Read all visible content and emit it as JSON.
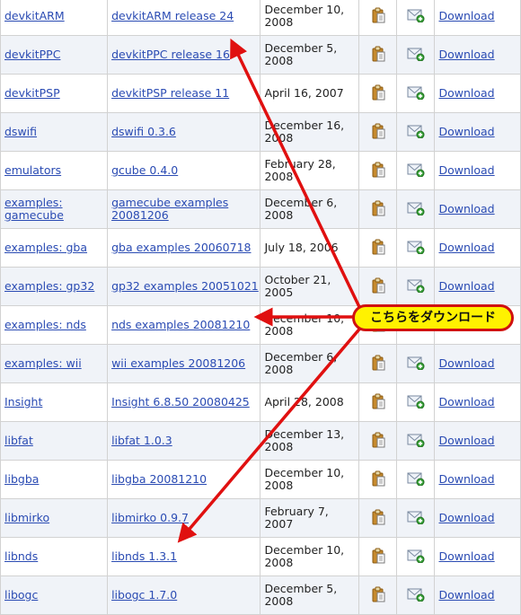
{
  "table": {
    "download_label": "Download",
    "rows": [
      {
        "package": "devkitARM",
        "release": "devkitARM release 24",
        "date": "December 10, 2008"
      },
      {
        "package": "devkitPPC",
        "release": "devkitPPC release 16",
        "date": "December 5, 2008"
      },
      {
        "package": "devkitPSP",
        "release": "devkitPSP release 11",
        "date": "April 16, 2007"
      },
      {
        "package": "dswifi",
        "release": "dswifi 0.3.6",
        "date": "December 16, 2008"
      },
      {
        "package": "emulators",
        "release": "gcube 0.4.0",
        "date": "February 28, 2008"
      },
      {
        "package": "examples: gamecube",
        "release": "gamecube examples 20081206",
        "date": "December 6, 2008"
      },
      {
        "package": "examples: gba",
        "release": "gba examples 20060718",
        "date": "July 18, 2006"
      },
      {
        "package": "examples: gp32",
        "release": "gp32 examples 20051021",
        "date": "October 21, 2005"
      },
      {
        "package": "examples: nds",
        "release": "nds examples 20081210",
        "date": "December 10, 2008"
      },
      {
        "package": "examples: wii",
        "release": "wii examples 20081206",
        "date": "December 6, 2008"
      },
      {
        "package": "Insight",
        "release": "Insight 6.8.50 20080425",
        "date": "April 28, 2008"
      },
      {
        "package": "libfat",
        "release": "libfat 1.0.3",
        "date": "December 13, 2008"
      },
      {
        "package": "libgba",
        "release": "libgba 20081210",
        "date": "December 10, 2008"
      },
      {
        "package": "libmirko",
        "release": "libmirko 0.9.7",
        "date": "February 7, 2007"
      },
      {
        "package": "libnds",
        "release": "libnds 1.3.1",
        "date": "December 10, 2008"
      },
      {
        "package": "libogc",
        "release": "libogc 1.7.0",
        "date": "December 5, 2008"
      }
    ]
  },
  "icons": {
    "notes": "clipboard-icon",
    "monitor": "envelope-add-icon"
  },
  "callout": {
    "text": "こちらをダウンロード"
  },
  "colors": {
    "link": "#2a4bb3",
    "row_alt": "#f0f3f8",
    "arrow": "#e01010",
    "callout_bg": "#fff200",
    "callout_border": "#d01010"
  }
}
